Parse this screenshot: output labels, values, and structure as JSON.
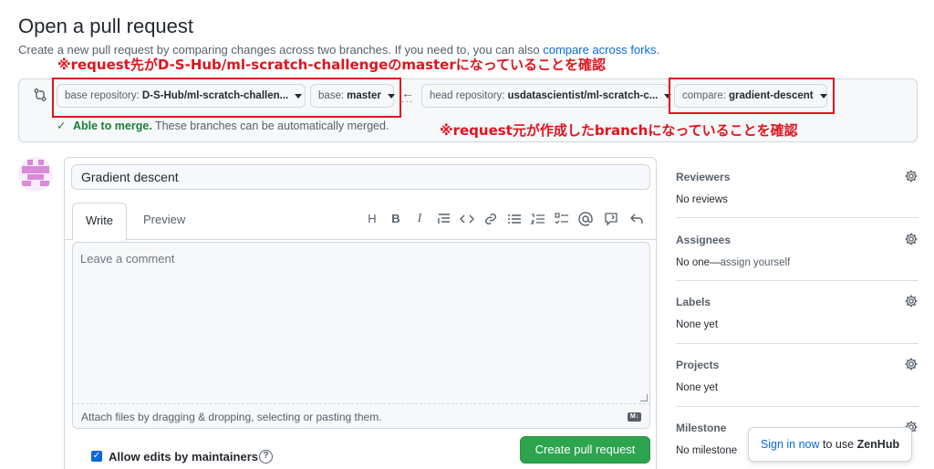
{
  "header": {
    "title": "Open a pull request",
    "subtitle": "Create a new pull request by comparing changes across two branches. If you need to, you can also",
    "compare_forks_link": "compare across forks."
  },
  "annotations": {
    "top": "※request先がD-S-Hub/ml-scratch-challengeのmasterになっていることを確認",
    "bottom": "※request元が作成したbranchになっていることを確認"
  },
  "range": {
    "base_repo_label": "base repository:",
    "base_repo_value": "D-S-Hub/ml-scratch-challen...",
    "base_label": "base:",
    "base_value": "master",
    "head_repo_label": "head repository:",
    "head_repo_value": "usdatascientist/ml-scratch-c...",
    "compare_label": "compare:",
    "compare_value": "gradient-descent",
    "merge_status": "Able to merge.",
    "merge_message": "These branches can be automatically merged."
  },
  "form": {
    "title_value": "Gradient descent",
    "tab_write": "Write",
    "tab_preview": "Preview",
    "comment_placeholder": "Leave a comment",
    "attach_text": "Attach files by dragging & dropping, selecting or pasting them.",
    "markdown_badge": "M↓",
    "allow_edits_label": "Allow edits by maintainers",
    "create_button": "Create pull request"
  },
  "toolbar_glyphs": {
    "heading": "H",
    "bold": "B",
    "italic": "I"
  },
  "sidebar": {
    "reviewers_title": "Reviewers",
    "reviewers_value": "No reviews",
    "assignees_title": "Assignees",
    "assignees_value": "No one—",
    "assignees_link": "assign yourself",
    "labels_title": "Labels",
    "labels_value": "None yet",
    "projects_title": "Projects",
    "projects_value": "None yet",
    "milestone_title": "Milestone",
    "milestone_value": "No milestone"
  },
  "zenhub": {
    "link": "Sign in now",
    "text": "to use",
    "brand": "ZenHub"
  },
  "colors": {
    "accent_blue": "#0969da",
    "success_green": "#2da44e",
    "annotation_red": "#e0141e"
  }
}
